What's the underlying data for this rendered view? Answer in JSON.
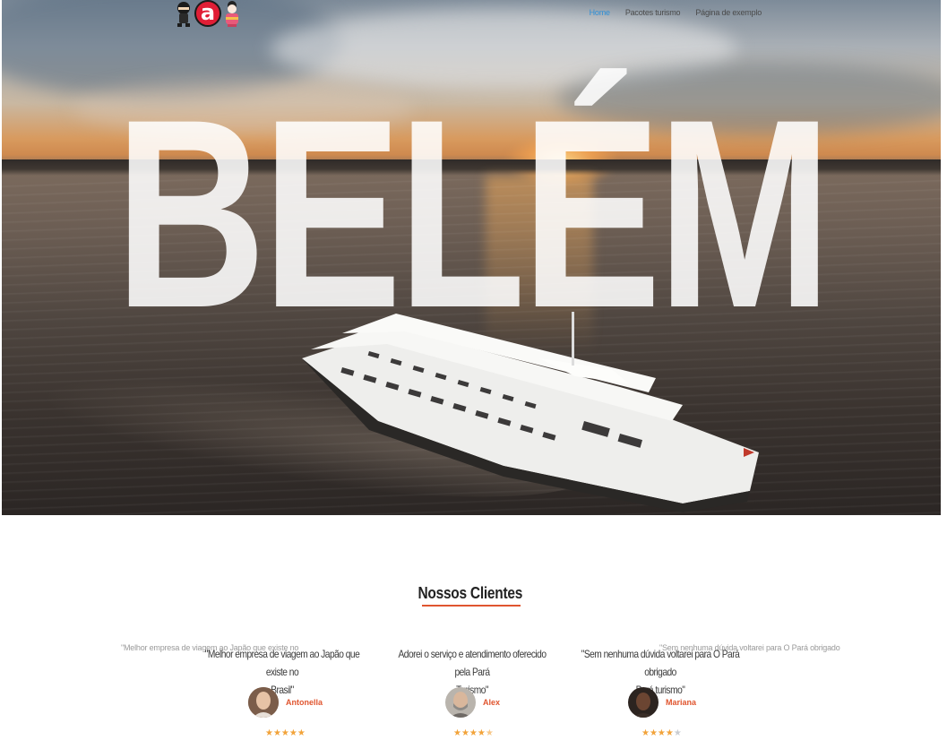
{
  "hero": {
    "city": "BELÉM"
  },
  "nav": {
    "items": [
      {
        "label": "Home",
        "active": true
      },
      {
        "label": "Pacotes turismo",
        "active": false
      },
      {
        "label": "Página de exemplo",
        "active": false
      }
    ]
  },
  "logo": {
    "letter": "a",
    "icons": [
      "ninja-icon",
      "logo-a-icon",
      "geisha-icon"
    ]
  },
  "clients": {
    "title": "Nossos Clientes",
    "ghost_quotes": [
      "\"Melhor empresa de viagem ao Japão que existe no",
      "\"Sem nenhuma dúvida voltarei para O Pará obrigado"
    ],
    "testimonials": [
      {
        "quote_line1": "\"Melhor empresa de viagem ao Japão que existe no",
        "quote_line2": "Brasil\"",
        "name": "Antonella",
        "rating": 5
      },
      {
        "quote_line1": "Adorei o serviço e atendimento oferecido pela Pará",
        "quote_line2": "Turismo\"",
        "name": "Alex",
        "rating": 4.5
      },
      {
        "quote_line1": "\"Sem nenhuma dúvida voltarei para O Pará obrigado",
        "quote_line2": "Pará turismo\"",
        "name": "Mariana",
        "rating": 4
      }
    ]
  },
  "colors": {
    "accent": "#e0552f",
    "nav_active": "#2f8fd6",
    "star": "#f2a33a"
  }
}
